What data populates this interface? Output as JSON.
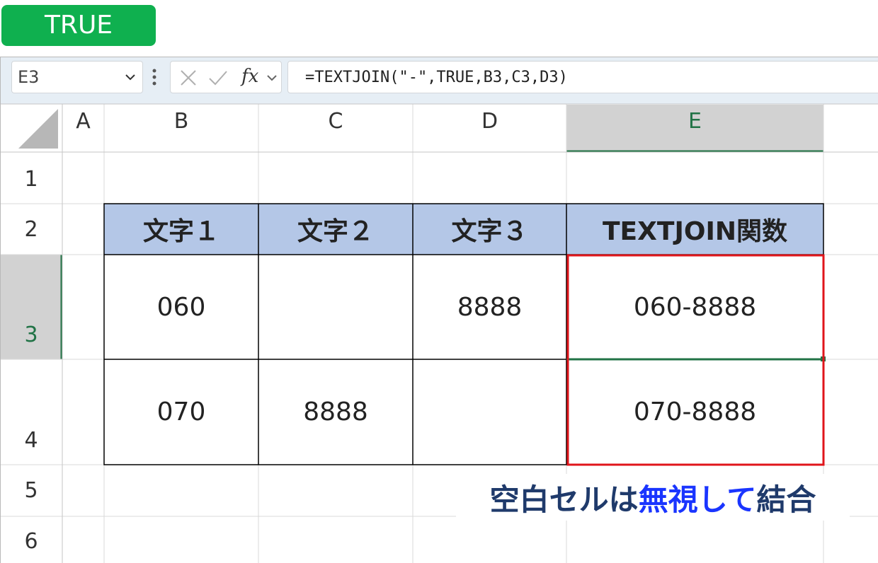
{
  "badge": {
    "label": "TRUE",
    "color": "#0fb04f"
  },
  "formula_bar": {
    "name_box": "E3",
    "fx_label": "fx",
    "formula": "=TEXTJOIN(\"-\",TRUE,B3,C3,D3)"
  },
  "columns": [
    "A",
    "B",
    "C",
    "D",
    "E"
  ],
  "rows": [
    "1",
    "2",
    "3",
    "4",
    "5",
    "6"
  ],
  "selected": {
    "cell": "E3",
    "accent": "#217346"
  },
  "table": {
    "headers": [
      "文字１",
      "文字２",
      "文字３",
      "TEXTJOIN関数"
    ],
    "rows": [
      [
        "060",
        "",
        "8888",
        "060-8888"
      ],
      [
        "070",
        "8888",
        "",
        "070-8888"
      ]
    ],
    "header_color": "#b4c7e7"
  },
  "highlight_color": "#e0151b",
  "note": {
    "part1": "空白セルは",
    "part2": "無視して",
    "part3": "結合"
  }
}
